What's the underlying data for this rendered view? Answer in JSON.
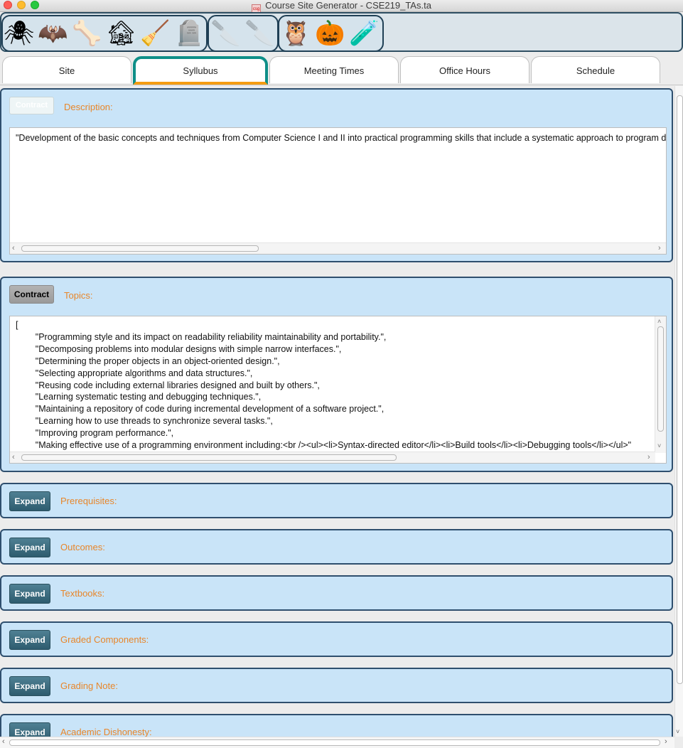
{
  "window": {
    "title": "Course Site Generator - CSE219_TAs.ta"
  },
  "toolbar": {
    "buttons": [
      {
        "icon": "spider-icon",
        "glyph": "🕷"
      },
      {
        "icon": "bat-icon",
        "glyph": "🦇"
      },
      {
        "icon": "bones-icon",
        "glyph": "🦴"
      },
      {
        "icon": "haunted-house-icon",
        "glyph": "🏚"
      },
      {
        "icon": "broom-icon",
        "glyph": "🧹"
      },
      {
        "icon": "tombstone-icon",
        "glyph": "🪦"
      },
      {
        "icon": "cleaver-icon",
        "glyph": "🔪",
        "disabled": true
      },
      {
        "icon": "cleaver-icon",
        "glyph": "🔪",
        "disabled": true
      },
      {
        "icon": "owl-icon",
        "glyph": "🦉"
      },
      {
        "icon": "pumpkin-icon",
        "glyph": "🎃"
      },
      {
        "icon": "cauldron-icon",
        "glyph": "🧪"
      }
    ]
  },
  "tabs": [
    {
      "label": "Site"
    },
    {
      "label": "Syllubus",
      "active": true
    },
    {
      "label": "Meeting Times"
    },
    {
      "label": "Office Hours"
    },
    {
      "label": "Schedule"
    }
  ],
  "sections": {
    "description": {
      "button": "Contract",
      "label": "Description:",
      "text": "\"Development of the basic concepts and techniques from Computer Science I and II into practical programming skills that include a systematic approach to program design, coding, testing, and debugging.\""
    },
    "topics": {
      "button": "Contract",
      "label": "Topics:",
      "text": "[\n        \"Programming style and its impact on readability reliability maintainability and portability.\",\n        \"Decomposing problems into modular designs with simple narrow interfaces.\",\n        \"Determining the proper objects in an object-oriented design.\",\n        \"Selecting appropriate algorithms and data structures.\",\n        \"Reusing code including external libraries designed and built by others.\",\n        \"Learning systematic testing and debugging techniques.\",\n        \"Maintaining a repository of code during incremental development of a software project.\",\n        \"Learning how to use threads to synchronize several tasks.\",\n        \"Improving program performance.\",\n        \"Making effective use of a programming environment including:<br /><ul><li>Syntax-directed editor</li><li>Build tools</li><li>Debugging tools</li></ul>\""
    },
    "collapsed": [
      {
        "button": "Expand",
        "label": "Prerequisites:"
      },
      {
        "button": "Expand",
        "label": "Outcomes:"
      },
      {
        "button": "Expand",
        "label": "Textbooks:"
      },
      {
        "button": "Expand",
        "label": "Graded Components:"
      },
      {
        "button": "Expand",
        "label": "Grading Note:"
      },
      {
        "button": "Expand",
        "label": "Academic Dishonesty:"
      }
    ]
  },
  "colors": {
    "section_bg": "#c9e4f8",
    "label_orange": "#e8862a",
    "tab_active_border": "#0f8f88",
    "tab_active_underline": "#f39c12"
  }
}
